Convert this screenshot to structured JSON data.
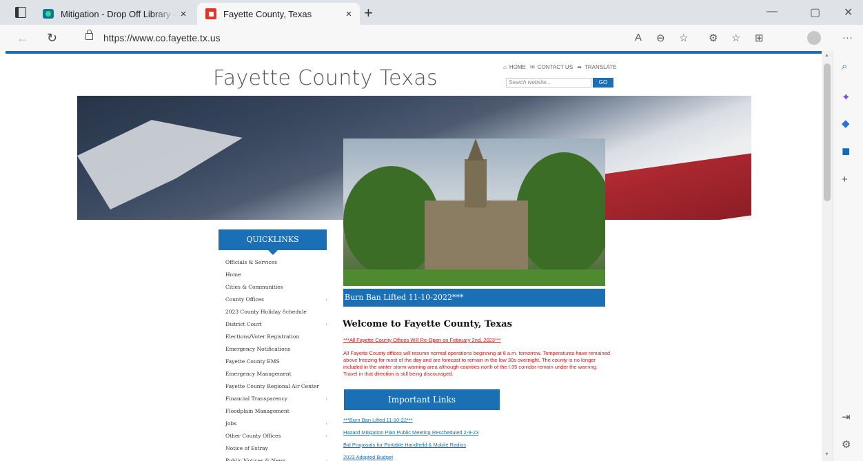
{
  "browser": {
    "tabs": [
      {
        "title": "Mitigation - Drop Off Library - A",
        "close": "×"
      },
      {
        "title": "Fayette County, Texas",
        "close": "×"
      }
    ],
    "new_tab": "+",
    "address": "https://www.co.fayette.tx.us",
    "window_controls": {
      "minimize": "—",
      "maximize": "▢",
      "close": "✕"
    },
    "toolbar_icons": [
      "read-aloud-icon",
      "zoom-icon",
      "favorite-icon",
      "extensions-icon",
      "favorites-icon",
      "collections-icon",
      "profile-icon",
      "more-icon"
    ],
    "more": "···"
  },
  "site": {
    "title": "Fayette County Texas",
    "util_links": [
      "HOME",
      "CONTACT US",
      "TRANSLATE"
    ],
    "search_placeholder": "Search website...",
    "go_label": "GO",
    "caption": "Burn Ban Lifted 11-10-2022***"
  },
  "quicklinks": {
    "heading": "QUICKLINKS",
    "items": [
      {
        "label": "Officials & Services",
        "arrow": ""
      },
      {
        "label": "Home",
        "arrow": ""
      },
      {
        "label": "Cities & Communities",
        "arrow": ""
      },
      {
        "label": "County Offices",
        "arrow": "›"
      },
      {
        "label": "2023 County Holiday Schedule",
        "arrow": ""
      },
      {
        "label": "District Court",
        "arrow": "›"
      },
      {
        "label": "Elections/Voter Registration",
        "arrow": ""
      },
      {
        "label": "Emergency Notifications",
        "arrow": ""
      },
      {
        "label": "Fayette County EMS",
        "arrow": ""
      },
      {
        "label": "Emergency Management",
        "arrow": ""
      },
      {
        "label": "Fayette County Regional Air Center",
        "arrow": ""
      },
      {
        "label": "Financial Transparency",
        "arrow": "›"
      },
      {
        "label": "Floodplain Management",
        "arrow": ""
      },
      {
        "label": "Jobs",
        "arrow": "›"
      },
      {
        "label": "Other County Offices",
        "arrow": "›"
      },
      {
        "label": "Notice of Estray",
        "arrow": ""
      },
      {
        "label": "Public Notices & News",
        "arrow": "›"
      }
    ]
  },
  "main": {
    "welcome": "Welcome to Fayette County, Texas",
    "alert_link": "***All Fayette County Offices Will Re-Open on February 2nd, 2023***",
    "alert_text": "All Fayette County offices will resume normal operations beginning at 8 a.m. tomorrow. Temperatures have remained above freezing for most of the day and are forecast to remain in the low 30s overnight. The county is no longer included in the winter storm warning area although counties north of the I 35 corridor remain under the warning. Travel in that direction is still being discouraged.",
    "important_heading": "Important Links",
    "important_links": [
      "***Burn Ban Lifted 11-10-22***",
      "Hazard Mitigation Plan Public Meeting Rescheduled 2-9-23",
      "Bid Proposals for Portable Handheld & Mobile Radios",
      "2023 Adopted Budget"
    ]
  },
  "colors": {
    "accent": "#1a6fb5",
    "alert": "#dd1111"
  }
}
